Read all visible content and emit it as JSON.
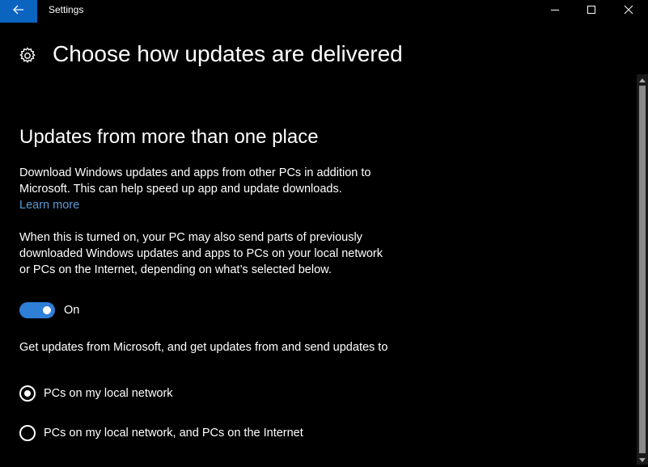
{
  "window": {
    "title": "Settings"
  },
  "page": {
    "title": "Choose how updates are delivered"
  },
  "section": {
    "heading": "Updates from more than one place",
    "intro": "Download Windows updates and apps from other PCs in addition to Microsoft. This can help speed up app and update downloads.",
    "learn_more": "Learn more",
    "description": "When this is turned on, your PC may also send parts of previously downloaded Windows updates and apps to PCs on your local network or PCs on the Internet, depending on what’s selected below.",
    "toggle": {
      "state_label": "On",
      "on": true
    },
    "radio_prompt": "Get updates from Microsoft, and get updates from and send updates to",
    "options": [
      {
        "label": "PCs on my local network",
        "selected": true
      },
      {
        "label": "PCs on my local network, and PCs on the Internet",
        "selected": false
      }
    ]
  },
  "icons": {
    "back": "back-arrow-icon",
    "minimize": "minimize-icon",
    "maximize": "maximize-icon",
    "close": "close-icon",
    "page": "gear-icon"
  },
  "colors": {
    "accent": "#0a64c0",
    "toggle_on": "#2f7ed8",
    "link": "#5b9bd5",
    "background": "#000000",
    "text": "#ffffff"
  }
}
